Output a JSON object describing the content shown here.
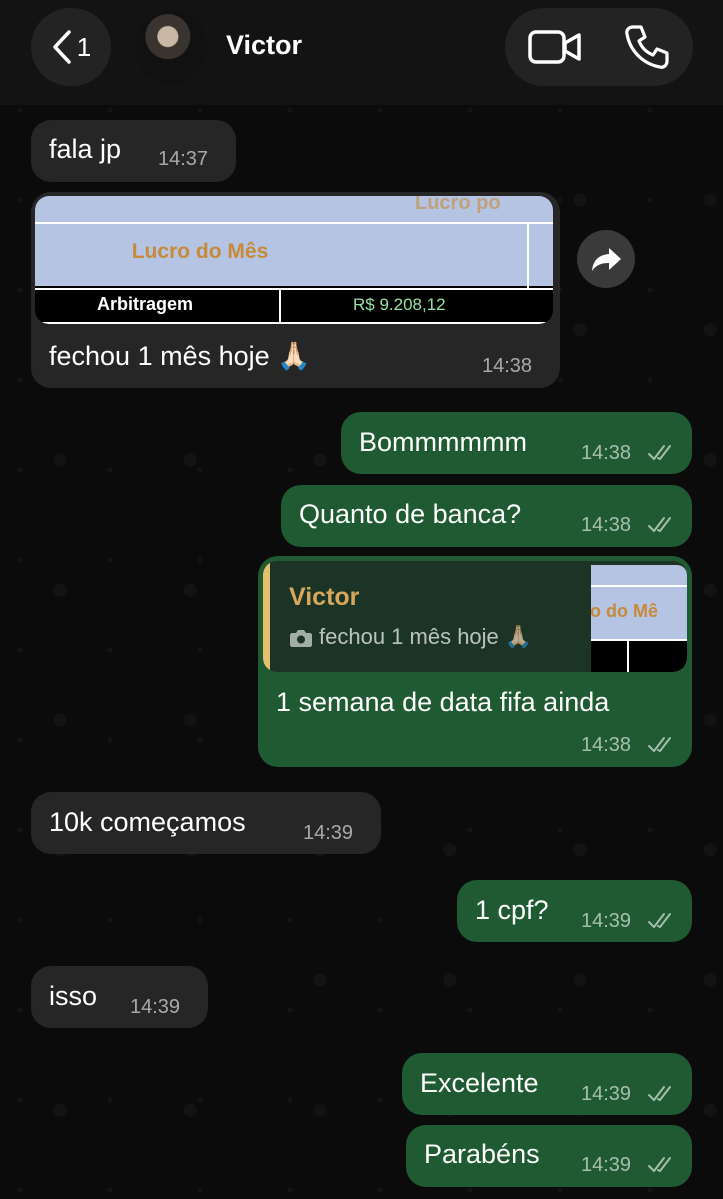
{
  "header": {
    "back_count": "1",
    "contact_name": "Victor"
  },
  "image_card": {
    "title": "Lucro do Mês",
    "row_label": "Arbitragem",
    "row_value": "R$ 9.208,12",
    "ghost_text": "Lucro po"
  },
  "messages": [
    {
      "dir": "in",
      "text": "fala jp",
      "time": "14:37"
    },
    {
      "dir": "in",
      "text": "fechou 1 mês hoje 🙏🏻",
      "time": "14:38"
    },
    {
      "dir": "out",
      "text": "Bommmmmm",
      "time": "14:38"
    },
    {
      "dir": "out",
      "text": "Quanto de banca?",
      "time": "14:38"
    },
    {
      "dir": "out",
      "text": "1 semana de data fifa ainda",
      "time": "14:38"
    },
    {
      "dir": "in",
      "text": "10k começamos",
      "time": "14:39"
    },
    {
      "dir": "out",
      "text": "1 cpf?",
      "time": "14:39"
    },
    {
      "dir": "in",
      "text": "isso",
      "time": "14:39"
    },
    {
      "dir": "out",
      "text": "Excelente",
      "time": "14:39"
    },
    {
      "dir": "out",
      "text": "Parabéns",
      "time": "14:39"
    }
  ],
  "reply_quote": {
    "name": "Victor",
    "text": "fechou 1 mês hoje 🙏🏻",
    "thumb_title": "ro do Mê"
  },
  "colors": {
    "incoming_bubble": "#262626",
    "outgoing_bubble": "#1f5a33",
    "quote_accent": "#e3c16f"
  }
}
